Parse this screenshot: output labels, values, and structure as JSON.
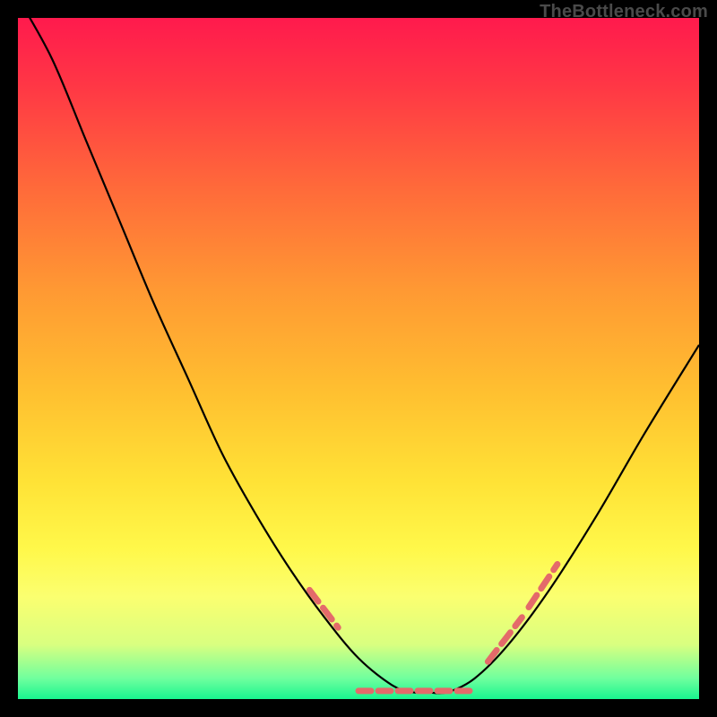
{
  "watermark": "TheBottleneck.com",
  "chart_data": {
    "type": "line",
    "title": "",
    "xlabel": "",
    "ylabel": "",
    "xlim": [
      0,
      1
    ],
    "ylim": [
      0,
      1
    ],
    "series": [
      {
        "name": "curve",
        "x": [
          0.0,
          0.05,
          0.1,
          0.15,
          0.2,
          0.25,
          0.3,
          0.35,
          0.4,
          0.45,
          0.5,
          0.55,
          0.58,
          0.6,
          0.63,
          0.67,
          0.72,
          0.78,
          0.85,
          0.92,
          1.0
        ],
        "y": [
          1.03,
          0.94,
          0.82,
          0.7,
          0.58,
          0.47,
          0.36,
          0.27,
          0.19,
          0.12,
          0.06,
          0.02,
          0.01,
          0.01,
          0.01,
          0.03,
          0.08,
          0.16,
          0.27,
          0.39,
          0.52
        ]
      }
    ],
    "dash_highlights": [
      {
        "x0": 0.428,
        "y0": 0.16,
        "x1": 0.47,
        "y1": 0.105
      },
      {
        "x0": 0.69,
        "y0": 0.055,
        "x1": 0.74,
        "y1": 0.12
      },
      {
        "x0": 0.75,
        "y0": 0.135,
        "x1": 0.792,
        "y1": 0.198
      }
    ],
    "gradient_bands": [
      {
        "name": "top-magenta",
        "approx_y": 1.0,
        "color": "#ff1a4d"
      },
      {
        "name": "red",
        "approx_y": 0.9,
        "color": "#ff3745"
      },
      {
        "name": "orange-red",
        "approx_y": 0.75,
        "color": "#ff6a3a"
      },
      {
        "name": "orange",
        "approx_y": 0.6,
        "color": "#ff9933"
      },
      {
        "name": "amber",
        "approx_y": 0.45,
        "color": "#ffc030"
      },
      {
        "name": "yellow",
        "approx_y": 0.32,
        "color": "#ffe236"
      },
      {
        "name": "bright-yellow",
        "approx_y": 0.22,
        "color": "#fff84a"
      },
      {
        "name": "pale-yellow",
        "approx_y": 0.15,
        "color": "#fbff70"
      },
      {
        "name": "yellow-green",
        "approx_y": 0.08,
        "color": "#d9ff80"
      },
      {
        "name": "green",
        "approx_y": 0.03,
        "color": "#6fff9e"
      },
      {
        "name": "bottom-green",
        "approx_y": 0.0,
        "color": "#18f58f"
      }
    ],
    "styles": {
      "curve_stroke": "#000000",
      "curve_width": 2.2,
      "dash_stroke": "#e46a6a",
      "dash_width": 7,
      "dash_pattern": "16 9"
    }
  }
}
